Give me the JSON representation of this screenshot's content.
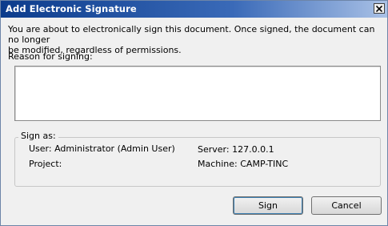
{
  "window": {
    "title": "Add Electronic Signature",
    "close_glyph": "close-icon"
  },
  "intro": {
    "line1": "You are about to electronically sign this document.  Once signed, the document can no longer",
    "line2": "be modified, regardless of permissions."
  },
  "reason": {
    "label": "Reason for signing:",
    "value": ""
  },
  "sign_as": {
    "legend": "Sign as:",
    "user": "User: Administrator (Admin User)",
    "project": "Project:",
    "server": "Server: 127.0.0.1",
    "machine": "Machine: CAMP-TINC"
  },
  "buttons": {
    "sign": "Sign",
    "cancel": "Cancel"
  }
}
